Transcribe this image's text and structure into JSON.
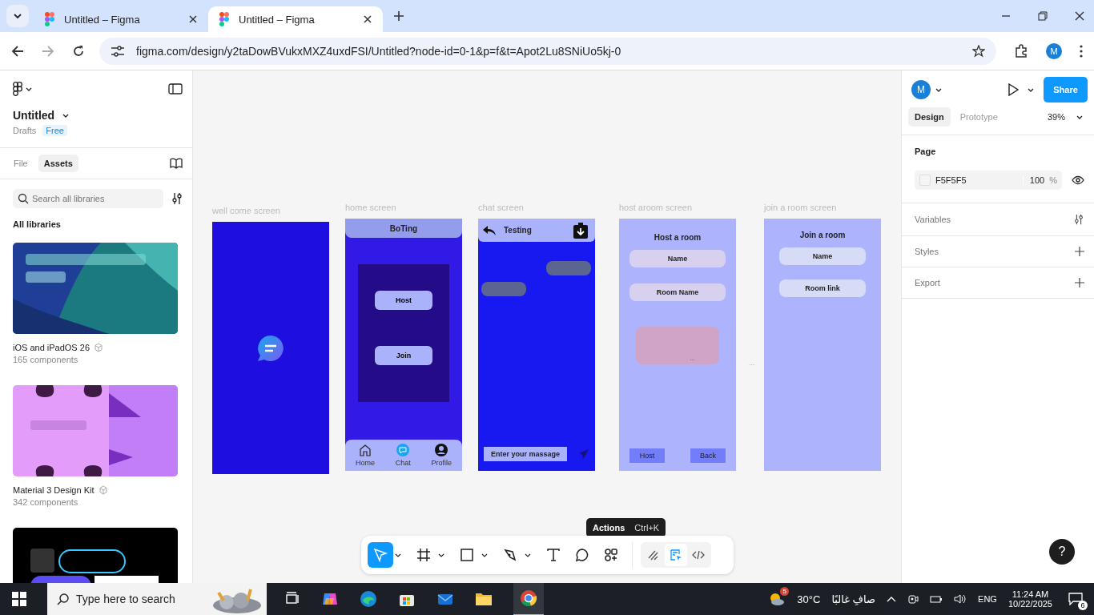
{
  "browser": {
    "tabs": [
      {
        "title": "Untitled – Figma",
        "selected": false
      },
      {
        "title": "Untitled – Figma",
        "selected": true
      }
    ],
    "url": "figma.com/design/y2taDowBVukxMXZ4uxdFSI/Untitled?node-id=0-1&p=f&t=Apot2Lu8SNiUo5kj-0",
    "avatar": "M"
  },
  "sidebar": {
    "file_title": "Untitled",
    "location": "Drafts",
    "plan": "Free",
    "tabs": [
      {
        "label": "File",
        "selected": false
      },
      {
        "label": "Assets",
        "selected": true
      }
    ],
    "search": {
      "placeholder": "Search all libraries"
    },
    "section": "All libraries",
    "libraries": [
      {
        "kind": "teal",
        "name": "iOS and iPadOS 26",
        "count": "165 components"
      },
      {
        "kind": "lilac",
        "name": "Material 3 Design Kit",
        "count": "342 components"
      },
      {
        "kind": "dark"
      }
    ]
  },
  "canvas": {
    "frames": [
      {
        "kind": "welcome",
        "label": "well come screen"
      },
      {
        "kind": "home",
        "label": "home screen",
        "header": "BoTing",
        "buttons": [
          "Host",
          "Join"
        ],
        "nav": [
          {
            "kind": "home",
            "label": "Home"
          },
          {
            "kind": "chat",
            "label": "Chat"
          },
          {
            "kind": "profile",
            "label": "Profile"
          }
        ]
      },
      {
        "kind": "chat",
        "label": "chat screen",
        "title": "Testing",
        "input": "Enter your massage"
      },
      {
        "kind": "host",
        "label": "host aroom screen",
        "title": "Host a room",
        "fields": [
          "Name",
          "Room Name"
        ],
        "note": "...",
        "buttons": [
          "Host",
          "Back"
        ]
      },
      {
        "kind": "join",
        "label": "join a room screen",
        "title": "Join a room",
        "fields": [
          "Name",
          "Room link"
        ]
      }
    ],
    "gap_mark": "...",
    "tooltip": {
      "label": "Actions",
      "shortcut": "Ctrl+K"
    },
    "tools": [
      {
        "kind": "move",
        "caret": true,
        "selected": true
      },
      {
        "kind": "frame",
        "caret": true,
        "selected": false
      },
      {
        "kind": "shape",
        "caret": true,
        "selected": false
      },
      {
        "kind": "pen",
        "caret": true,
        "selected": false
      },
      {
        "kind": "text",
        "caret": false,
        "selected": false
      },
      {
        "kind": "comment",
        "caret": false,
        "selected": false
      },
      {
        "kind": "actions",
        "caret": false,
        "selected": false
      }
    ],
    "modes": [
      {
        "kind": "draw",
        "selected": false
      },
      {
        "kind": "design",
        "selected": true
      },
      {
        "kind": "dev",
        "selected": false
      }
    ]
  },
  "panel": {
    "avatar": "M",
    "share": "Share",
    "tabs": [
      {
        "label": "Design",
        "selected": true
      },
      {
        "label": "Prototype",
        "selected": false
      }
    ],
    "zoom": "39%",
    "page": {
      "title": "Page",
      "color": "F5F5F5",
      "opacity": "100",
      "unit": "%"
    },
    "sections": [
      {
        "kind": "settings",
        "label": "Variables"
      },
      {
        "kind": "add",
        "label": "Styles"
      },
      {
        "kind": "add",
        "label": "Export"
      }
    ],
    "help": "?"
  },
  "taskbar": {
    "search": {
      "placeholder": "Type here to search"
    },
    "weather_badge": "5",
    "temperature": "30°C",
    "weather": "صافِ غالبًا",
    "language": "ENG",
    "time": "11:24 AM",
    "date": "10/22/2025",
    "notifications": "6"
  }
}
